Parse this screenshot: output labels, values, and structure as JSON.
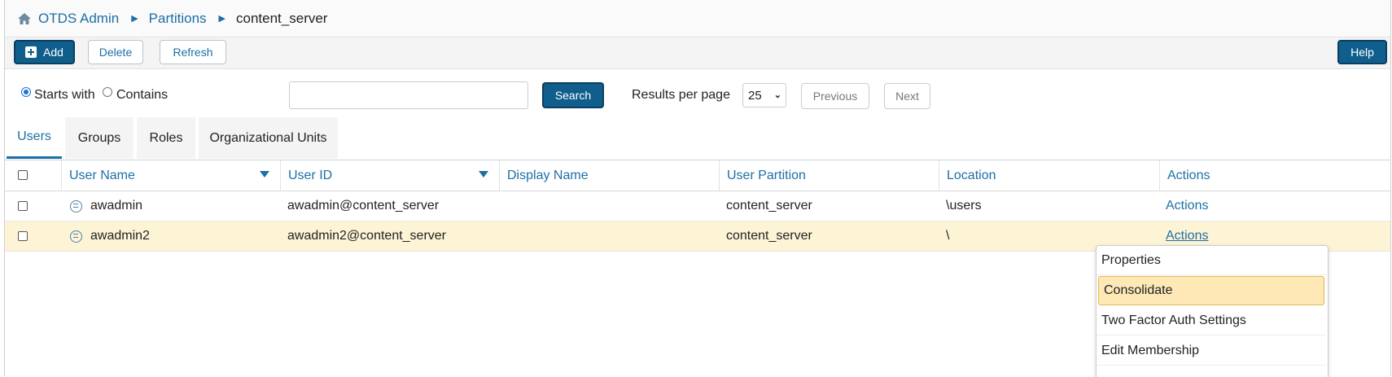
{
  "breadcrumb": {
    "home_icon": "home-icon",
    "items": [
      "OTDS Admin",
      "Partitions"
    ],
    "current": "content_server"
  },
  "toolbar": {
    "add_label": "Add",
    "delete_label": "Delete",
    "refresh_label": "Refresh",
    "help_label": "Help"
  },
  "search": {
    "starts_with_label": "Starts with",
    "contains_label": "Contains",
    "selected_mode": "Starts with",
    "query_value": "",
    "search_label": "Search",
    "results_per_page_label": "Results per page",
    "results_per_page_value": "25",
    "previous_label": "Previous",
    "next_label": "Next"
  },
  "tabs": [
    {
      "label": "Users",
      "active": true
    },
    {
      "label": "Groups",
      "active": false
    },
    {
      "label": "Roles",
      "active": false
    },
    {
      "label": "Organizational Units",
      "active": false
    }
  ],
  "table": {
    "columns": [
      "User Name",
      "User ID",
      "Display Name",
      "User Partition",
      "Location",
      "Actions"
    ],
    "rows": [
      {
        "user_name": "awadmin",
        "user_id": "awadmin@content_server",
        "display_name": "",
        "partition": "content_server",
        "location": "\\users",
        "actions": "Actions",
        "highlighted": false
      },
      {
        "user_name": "awadmin2",
        "user_id": "awadmin2@content_server",
        "display_name": "",
        "partition": "content_server",
        "location": "\\",
        "actions": "Actions",
        "highlighted": true
      }
    ]
  },
  "actions_menu": {
    "items": [
      "Properties",
      "Consolidate",
      "Two Factor Auth Settings",
      "Edit Membership"
    ],
    "hovered": "Consolidate"
  },
  "colors": {
    "link": "#1d6fa5",
    "primary_button": "#0f5e8c",
    "row_highlight": "#fdf4d6",
    "menu_hover": "#fde8b6"
  }
}
